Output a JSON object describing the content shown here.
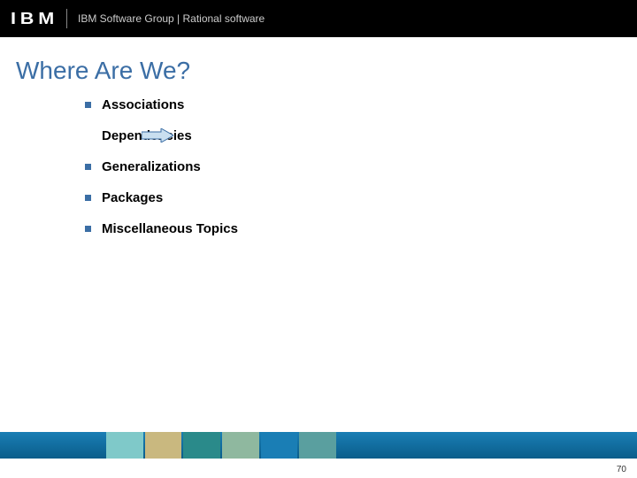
{
  "header": {
    "logo_text": "IBM",
    "group_text": "IBM Software Group | Rational software"
  },
  "slide": {
    "title": "Where Are We?"
  },
  "bullets": {
    "item0": "Associations",
    "item1": "Dependencies",
    "item2": "Generalizations",
    "item3": "Packages",
    "item4": "Miscellaneous Topics"
  },
  "page_number": "70"
}
